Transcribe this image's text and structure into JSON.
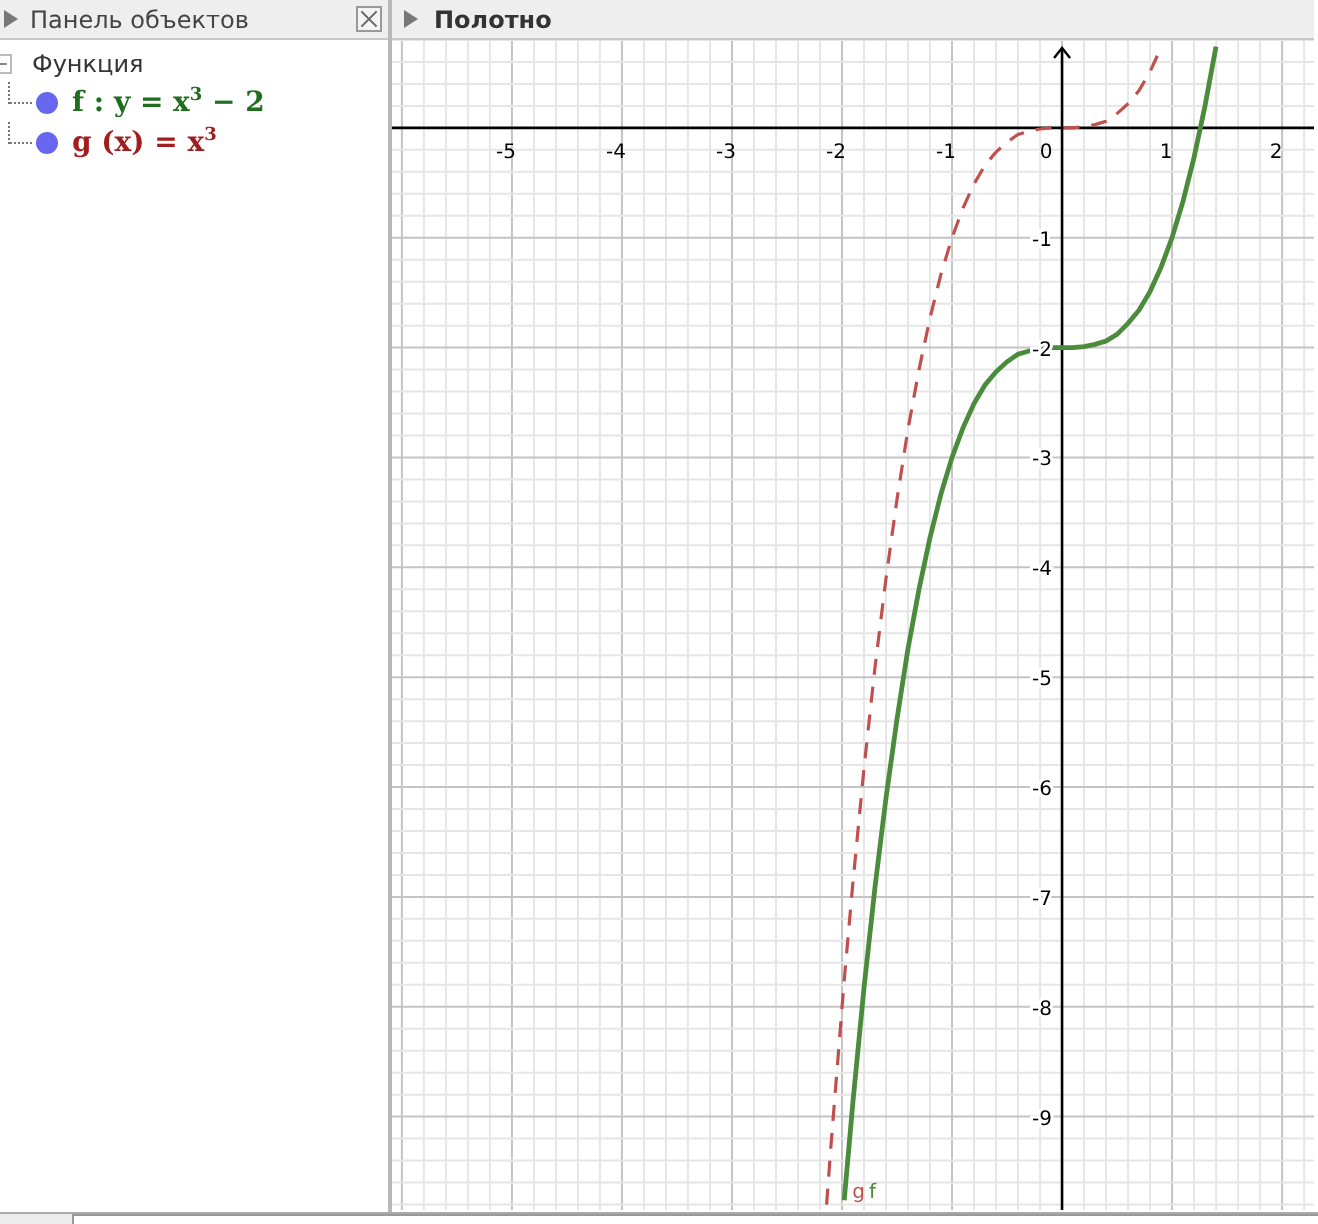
{
  "algebra_panel": {
    "title": "Панель объектов",
    "tree": [
      {
        "label": "Функция",
        "expanded": true,
        "children": [
          {
            "label": "f : y = x$^{3}$ − 2",
            "color": "#1e6e1e",
            "visible": true
          },
          {
            "label": "g (x) = x$^{3}$",
            "color": "#a01e1e",
            "visible": true
          }
        ]
      }
    ]
  },
  "graphics_view": {
    "title": "Полотно",
    "chart_data": {
      "type": "line",
      "grid": true,
      "x": [
        -2.14,
        -2.1,
        -1.98,
        -1.9,
        -1.8,
        -1.7,
        -1.6,
        -1.5,
        -1.4,
        -1.3,
        -1.2,
        -1.1,
        -1.0,
        -0.9,
        -0.8,
        -0.7,
        -0.6,
        -0.5,
        -0.4,
        -0.3,
        -0.2,
        -0.1,
        0,
        0.1,
        0.2,
        0.3,
        0.4,
        0.5,
        0.6,
        0.7,
        0.8,
        0.9,
        1.0,
        1.1,
        1.2,
        1.3,
        1.4
      ],
      "series": [
        {
          "name": "f",
          "color": "#4a8c3c",
          "line_style": "solid",
          "values": [
            null,
            null,
            -9.76,
            -8.86,
            -7.83,
            -6.91,
            -6.1,
            -5.38,
            -4.74,
            -4.2,
            -3.73,
            -3.33,
            -3,
            -2.73,
            -2.51,
            -2.34,
            -2.22,
            -2.13,
            -2.06,
            -2.03,
            -2.01,
            -2,
            -2,
            -2,
            -1.99,
            -1.97,
            -1.94,
            -1.88,
            -1.78,
            -1.66,
            -1.49,
            -1.27,
            -1,
            -0.67,
            -0.27,
            0.2,
            0.74
          ]
        },
        {
          "name": "g",
          "color": "#c0504d",
          "line_style": "dashed",
          "values": [
            -9.8,
            -9.26,
            -7.76,
            -6.86,
            -5.83,
            -4.91,
            -4.1,
            -3.38,
            -2.74,
            -2.2,
            -1.73,
            -1.33,
            -1,
            -0.73,
            -0.51,
            -0.34,
            -0.22,
            -0.13,
            -0.06,
            -0.03,
            -0.01,
            0,
            0,
            0,
            0.01,
            0.03,
            0.06,
            0.13,
            0.22,
            0.34,
            0.51,
            0.73,
            null,
            null,
            null,
            null,
            null
          ]
        }
      ],
      "xlim": [
        -6.09,
        2.29
      ],
      "ylim": [
        -9.85,
        0.8
      ],
      "xticks": [
        -5,
        -4,
        -3,
        -2,
        -1,
        0,
        1,
        2
      ],
      "yticks": [
        -9,
        -8,
        -7,
        -6,
        -5,
        -4,
        -3,
        -2,
        -1
      ]
    }
  }
}
